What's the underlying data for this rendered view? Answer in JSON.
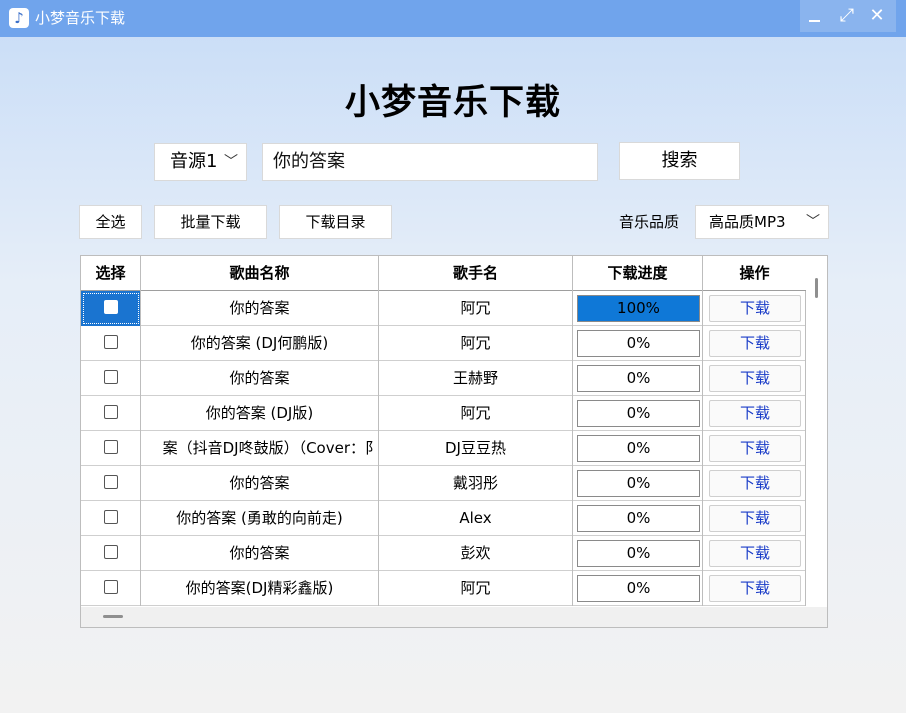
{
  "window": {
    "title": "小梦音乐下载",
    "icon": "music-note-icon",
    "controls": {
      "minimize": "minimize-icon",
      "maximize": "maximize-icon",
      "close": "✕"
    }
  },
  "header": {
    "title": "小梦音乐下载"
  },
  "search": {
    "source_selected": "音源1",
    "query": "你的答案",
    "button_label": "搜索"
  },
  "toolbar": {
    "select_all_label": "全选",
    "batch_download_label": "批量下载",
    "download_dir_label": "下载目录",
    "quality_label": "音乐品质",
    "quality_selected": "高品质MP3"
  },
  "table": {
    "columns": [
      "选择",
      "歌曲名称",
      "歌手名",
      "下载进度",
      "操作"
    ],
    "rows": [
      {
        "name": "你的答案",
        "artist": "阿冗",
        "progress": "100%",
        "progress_value": 100,
        "action": "下载",
        "selected": true
      },
      {
        "name": "你的答案 (DJ何鹏版)",
        "artist": "阿冗",
        "progress": "0%",
        "progress_value": 0,
        "action": "下载",
        "selected": false
      },
      {
        "name": "你的答案",
        "artist": "王赫野",
        "progress": "0%",
        "progress_value": 0,
        "action": "下载",
        "selected": false
      },
      {
        "name": "你的答案 (DJ版)",
        "artist": "阿冗",
        "progress": "0%",
        "progress_value": 0,
        "action": "下载",
        "selected": false
      },
      {
        "name": "你的答案（抖音DJ咚鼓版）（Cover：阿冗）",
        "name_visible": "案（抖音DJ咚鼓版）（Cover：阝",
        "artist": "DJ豆豆热",
        "progress": "0%",
        "progress_value": 0,
        "action": "下载",
        "selected": false
      },
      {
        "name": "你的答案",
        "artist": "戴羽彤",
        "progress": "0%",
        "progress_value": 0,
        "action": "下载",
        "selected": false
      },
      {
        "name": "你的答案 (勇敢的向前走)",
        "artist": "Alex",
        "progress": "0%",
        "progress_value": 0,
        "action": "下载",
        "selected": false
      },
      {
        "name": "你的答案",
        "artist": "彭欢",
        "progress": "0%",
        "progress_value": 0,
        "action": "下载",
        "selected": false
      },
      {
        "name": "你的答案(DJ精彩鑫版)",
        "artist": "阿冗",
        "progress": "0%",
        "progress_value": 0,
        "action": "下载",
        "selected": false
      }
    ]
  },
  "colors": {
    "titlebar": "#70a4ec",
    "progress_fill": "#0f78d7",
    "link_text": "#1a3cc8"
  }
}
